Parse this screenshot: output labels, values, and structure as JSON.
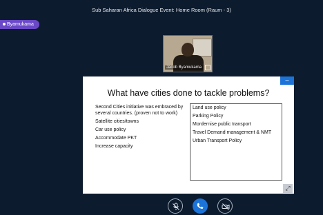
{
  "window": {
    "title": "Sub Saharan Africa Dialogue Event: Home Room (Raum - 3)"
  },
  "active_speaker": {
    "name": "Byamukama"
  },
  "video_tile": {
    "name": "Jacob Byamukama"
  },
  "slide": {
    "title": "What have cities done to tackle problems?",
    "left_items": [
      "Second Cities initiative was embraced by several countries. (proven not to work)",
      "Satellite cities/towns",
      "Car use policy",
      "Accommodate PKT",
      "Increase capacity"
    ],
    "right_items": [
      "Land use policy",
      "Parking Policy",
      "Mordernise public transport",
      "Travel Demand management & NMT",
      "Urban Transport Policy"
    ],
    "minimize_symbol": "–",
    "expand_symbol": "⤢"
  },
  "controls": {
    "mic_icon": "mic-muted-icon",
    "call_icon": "phone-icon",
    "camera_icon": "camera-off-icon"
  },
  "colors": {
    "background": "#0d1b2e",
    "accent": "#1c74d9",
    "speaker_pill": "#6a49c7"
  }
}
